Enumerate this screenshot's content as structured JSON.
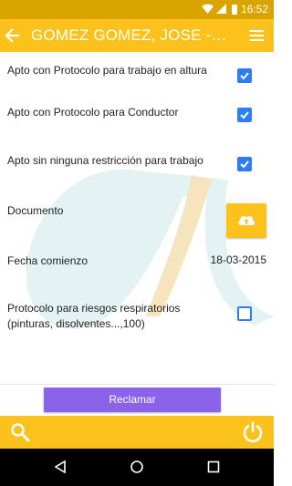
{
  "status_bar": {
    "time": "16:52"
  },
  "app_bar": {
    "title": "GOMEZ GOMEZ, JOSE - C..."
  },
  "rows": {
    "apto_altura": {
      "label": "Apto con Protocolo para trabajo en altura",
      "checked": true
    },
    "apto_conductor": {
      "label": "Apto con Protocolo para Conductor",
      "checked": true
    },
    "apto_sin_restriccion": {
      "label": "Apto sin ninguna restricción para trabajo",
      "checked": true
    },
    "documento": {
      "label": "Documento",
      "icon": "cloud-upload-icon"
    },
    "fecha_comienzo": {
      "label": "Fecha comienzo",
      "value": "18-03-2015"
    },
    "protocolo_respiratorios": {
      "label": "Protocolo para riesgos respiratorios (pinturas, disolventes...,100)",
      "checked": false
    }
  },
  "footer": {
    "button_label": "Reclamar"
  },
  "bottom_bar": {
    "left_icon": "search-icon",
    "right_icon": "power-icon"
  },
  "colors": {
    "accent": "#fbc21b",
    "status_bar": "#d9a400",
    "button": "#8b63e8",
    "checkbox": "#2e7cf6"
  }
}
